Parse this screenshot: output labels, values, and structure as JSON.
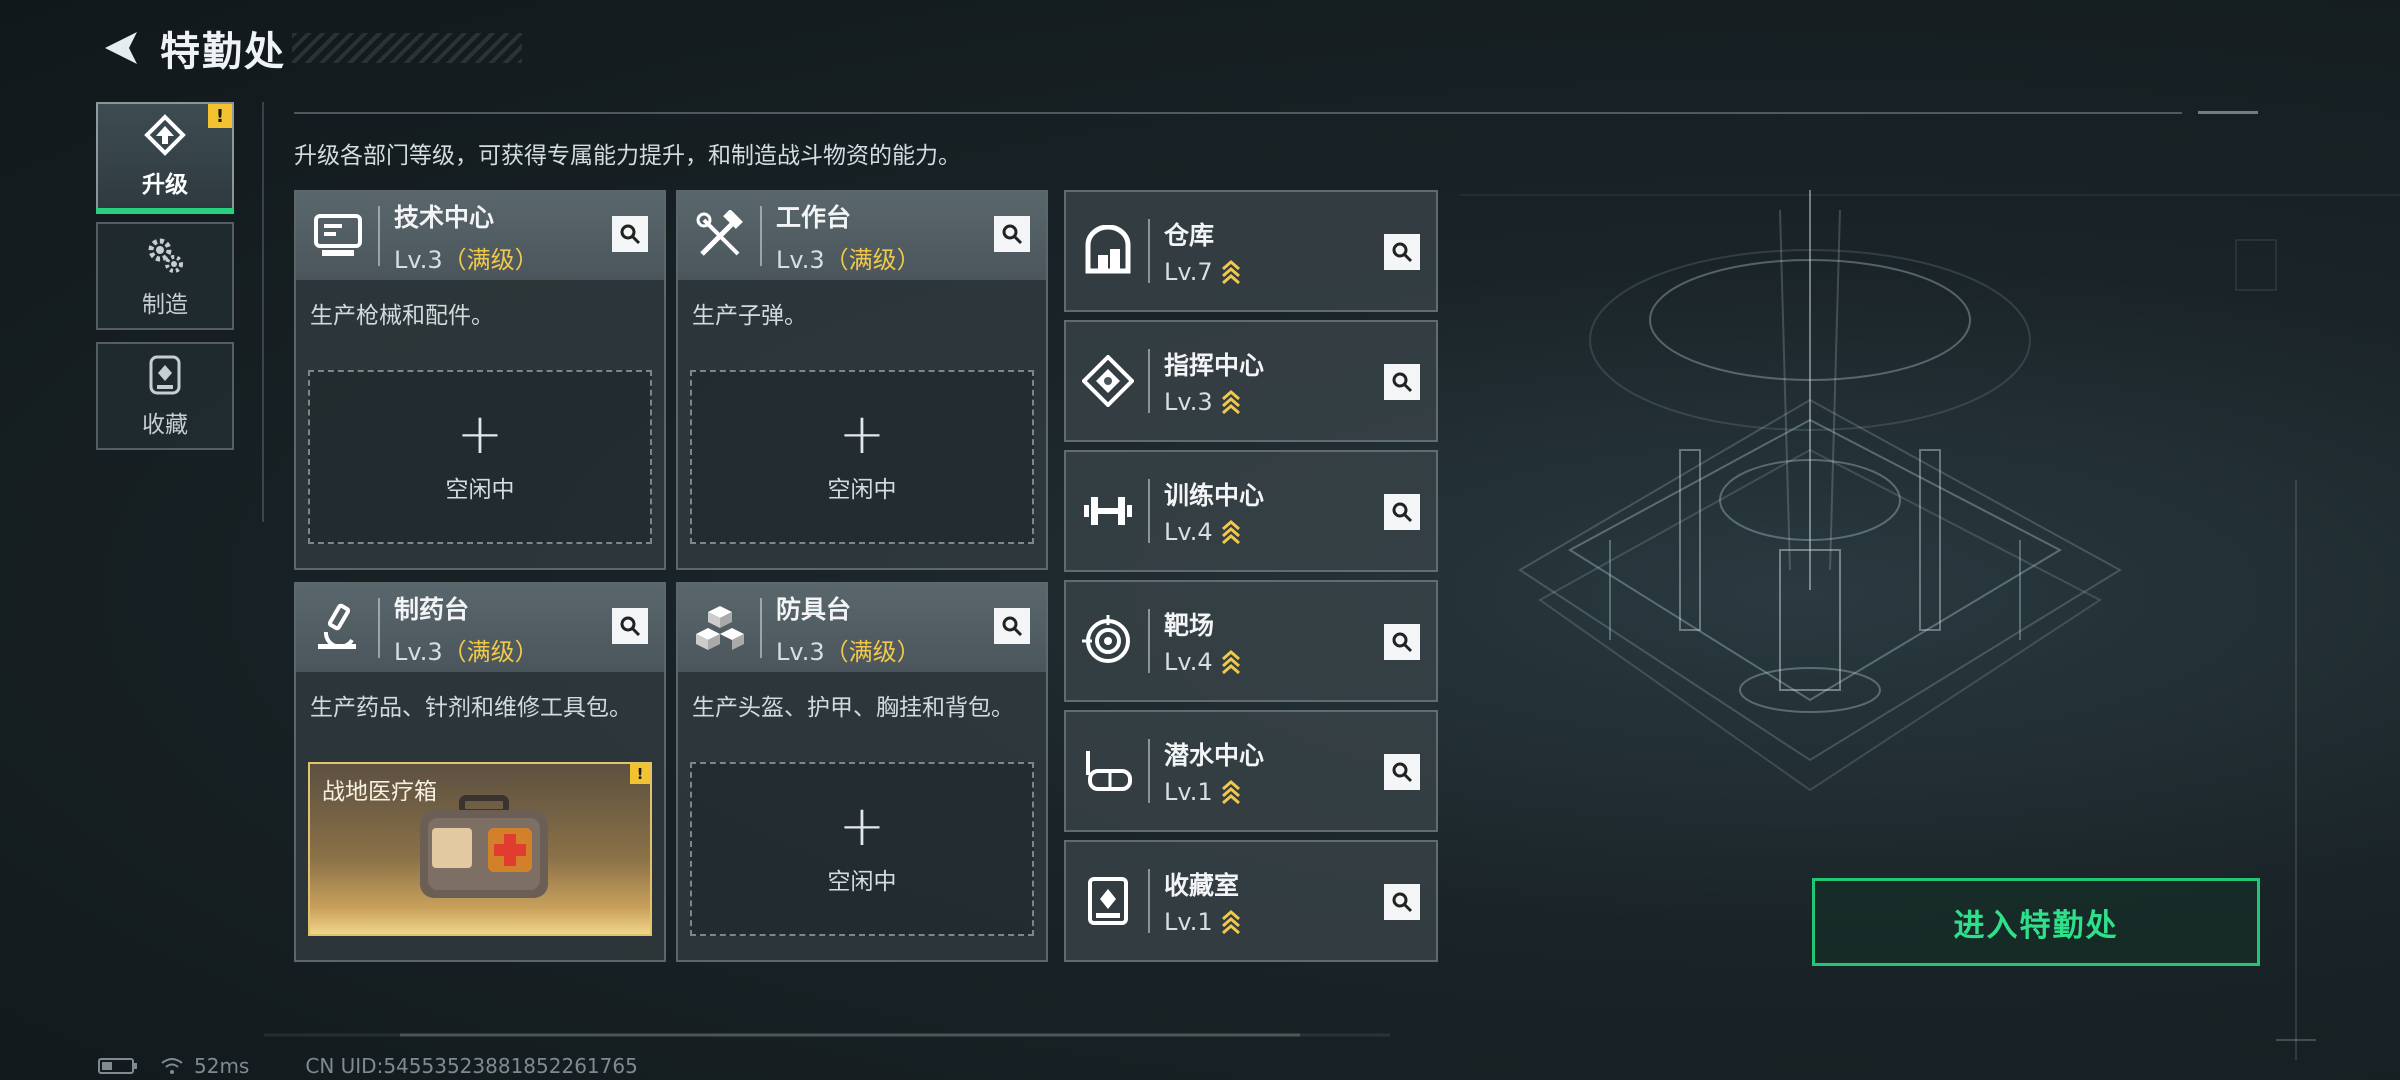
{
  "header": {
    "title": "特勤处"
  },
  "nav": [
    {
      "label": "升级",
      "icon": "upgrade-icon",
      "active": true,
      "alert": "!"
    },
    {
      "label": "制造",
      "icon": "gears-icon"
    },
    {
      "label": "收藏",
      "icon": "collection-icon"
    }
  ],
  "description": "升级各部门等级，可获得专属能力提升，和制造战斗物资的能力。",
  "main_departments": [
    {
      "name": "技术中心",
      "level": "Lv.3",
      "max_tag": "（满级）",
      "desc": "生产枪械和配件。",
      "slot": {
        "type": "idle",
        "plus": "+",
        "label": "空闲中"
      },
      "icon": "computer-icon"
    },
    {
      "name": "工作台",
      "level": "Lv.3",
      "max_tag": "（满级）",
      "desc": "生产子弹。",
      "slot": {
        "type": "idle",
        "plus": "+",
        "label": "空闲中"
      },
      "icon": "tools-icon"
    },
    {
      "name": "制药台",
      "level": "Lv.3",
      "max_tag": "（满级）",
      "desc": "生产药品、针剂和维修工具包。",
      "slot": {
        "type": "item",
        "label": "战地医疗箱",
        "alert": "!"
      },
      "icon": "microscope-icon"
    },
    {
      "name": "防具台",
      "level": "Lv.3",
      "max_tag": "（满级）",
      "desc": "生产头盔、护甲、胸挂和背包。",
      "slot": {
        "type": "idle",
        "plus": "+",
        "label": "空闲中"
      },
      "icon": "armor-boxes-icon"
    }
  ],
  "side_departments": [
    {
      "name": "仓库",
      "level": "Lv.7",
      "icon": "warehouse-icon"
    },
    {
      "name": "指挥中心",
      "level": "Lv.3",
      "icon": "command-icon"
    },
    {
      "name": "训练中心",
      "level": "Lv.4",
      "icon": "dumbbell-icon"
    },
    {
      "name": "靶场",
      "level": "Lv.4",
      "icon": "target-icon"
    },
    {
      "name": "潜水中心",
      "level": "Lv.1",
      "icon": "dive-mask-icon"
    },
    {
      "name": "收藏室",
      "level": "Lv.1",
      "icon": "trophy-case-icon"
    }
  ],
  "enter_button": "进入特勤处",
  "status": {
    "ping": "52ms",
    "uid": "CN UID:5455352388185226176​5"
  },
  "colors": {
    "accent": "#29d07d",
    "max_level": "#f1c84b",
    "alert": "#f2c230"
  }
}
